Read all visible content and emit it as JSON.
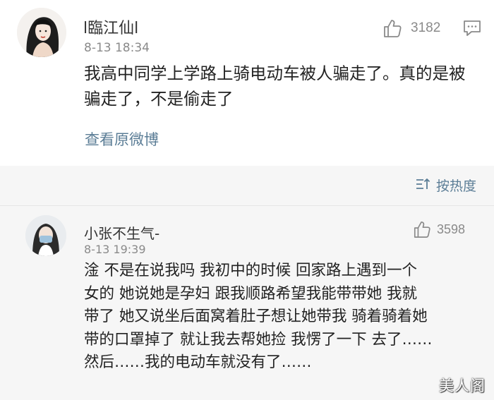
{
  "main_comment": {
    "username": "l臨江仙l",
    "time": "8-13 18:34",
    "like_count": "3182",
    "text": "我高中同学上学路上骑电动车被人骗走了。真的是被骗走了，不是偷走了",
    "view_original_label": "查看原微博"
  },
  "replies_section": {
    "sort_label": "按热度",
    "reply": {
      "username": "小张不生气-",
      "time": "8-13 19:39",
      "like_count": "3598",
      "lines": [
        "淦 不是在说我吗 我初中的时候 回家路上遇到一个",
        "女的 她说她是孕妇 跟我顺路希望我能带带她 我就",
        "带了 她又说坐后面窝着肚子想让她带我 骑着骑着她",
        "带的口罩掉了 就让我去帮她捡 我愣了一下 去了……",
        "然后……我的电动车就没有了……"
      ]
    }
  },
  "watermark": "美人阁",
  "colors": {
    "link": "#5b7d96",
    "meta": "#8a8a8a",
    "text": "#222222",
    "section_bg": "#f6f6f6"
  },
  "icons": [
    "thumbs-up-icon",
    "comment-icon",
    "sort-icon"
  ]
}
